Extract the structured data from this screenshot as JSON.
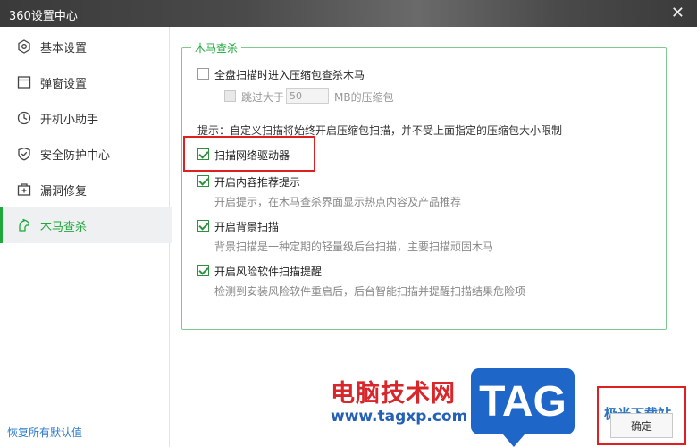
{
  "window": {
    "title": "360设置中心",
    "close_glyph": "✕"
  },
  "sidebar": {
    "items": [
      {
        "label": "基本设置",
        "icon": "gear-icon"
      },
      {
        "label": "弹窗设置",
        "icon": "window-icon"
      },
      {
        "label": "开机小助手",
        "icon": "clock-icon"
      },
      {
        "label": "安全防护中心",
        "icon": "shield-icon"
      },
      {
        "label": "漏洞修复",
        "icon": "patch-icon"
      },
      {
        "label": "木马查杀",
        "icon": "trojan-icon",
        "active": true
      }
    ],
    "restore_label": "恢复所有默认值"
  },
  "trojan": {
    "group_title": "木马查杀",
    "full_scan": {
      "label": "全盘扫描时进入压缩包查杀木马",
      "checked": false
    },
    "skip_large": {
      "prefix": "跳过大于",
      "value": "50",
      "suffix": "MB的压缩包",
      "checked": false,
      "disabled": true
    },
    "hint": "提示：自定义扫描将始终开启压缩包扫描，并不受上面指定的压缩包大小限制",
    "scan_network_driver": {
      "label": "扫描网络驱动器",
      "checked": true
    },
    "content_tips": {
      "label": "开启内容推荐提示",
      "desc": "开启提示，在木马查杀界面显示热点内容及产品推荐",
      "checked": true
    },
    "background_scan": {
      "label": "开启背景扫描",
      "desc": "背景扫描是一种定期的轻量级后台扫描，主要扫描顽固木马",
      "checked": true
    },
    "risk_software": {
      "label": "开启风险软件扫描提醒",
      "desc": "检测到安装风险软件重启后，后台智能扫描并提醒扫描结果危险项",
      "checked": true
    }
  },
  "footer": {
    "ok_label": "确定"
  },
  "watermark": {
    "text": "电脑技术网",
    "url": "www.tagxp.com",
    "badge": "TAG",
    "right_text": "极光下载站"
  },
  "colors": {
    "accent": "#1fa83c",
    "highlight": "#e02020",
    "link": "#2c7acb"
  }
}
